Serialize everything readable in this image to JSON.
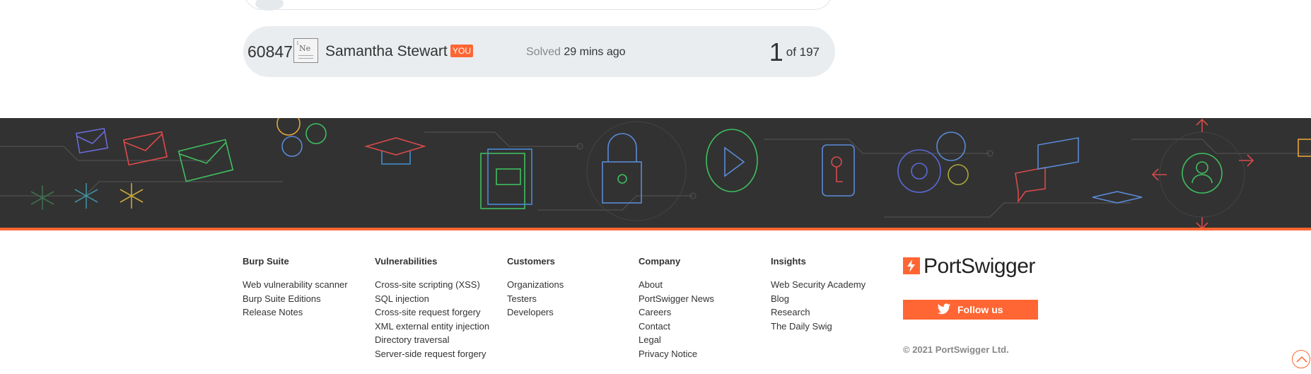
{
  "leaderboard": {
    "rank": "60847",
    "avatar_symbol": "Ne",
    "username": "Samantha Stewart",
    "you_badge": "YOU",
    "solved_label": "Solved",
    "solved_time": "29 mins ago",
    "position": "1",
    "position_total": "of 197"
  },
  "footer": {
    "columns": [
      {
        "title": "Burp Suite",
        "links": [
          "Web vulnerability scanner",
          "Burp Suite Editions",
          "Release Notes"
        ]
      },
      {
        "title": "Vulnerabilities",
        "links": [
          "Cross-site scripting (XSS)",
          "SQL injection",
          "Cross-site request forgery",
          "XML external entity injection",
          "Directory traversal",
          "Server-side request forgery"
        ]
      },
      {
        "title": "Customers",
        "links": [
          "Organizations",
          "Testers",
          "Developers"
        ]
      },
      {
        "title": "Company",
        "links": [
          "About",
          "PortSwigger News",
          "Careers",
          "Contact",
          "Legal",
          "Privacy Notice"
        ]
      },
      {
        "title": "Insights",
        "links": [
          "Web Security Academy",
          "Blog",
          "Research",
          "The Daily Swig"
        ]
      }
    ],
    "brand": "PortSwigger",
    "follow_label": "Follow us",
    "copyright": "© 2021 PortSwigger Ltd."
  },
  "colors": {
    "accent": "#ff6633",
    "banner_bg": "#323232",
    "row_bg": "#e9edf0"
  }
}
